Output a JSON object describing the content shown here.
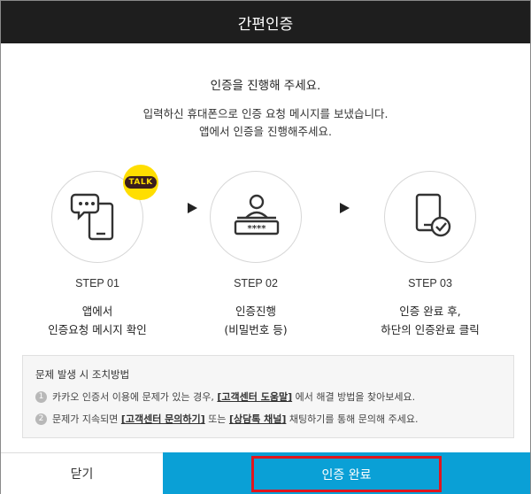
{
  "header": {
    "title": "간편인증"
  },
  "intro": {
    "lead": "인증을 진행해 주세요.",
    "desc_line1": "입력하신 휴대폰으로 인증 요청 메시지를 보냈습니다.",
    "desc_line2": "앱에서 인증을 진행해주세요."
  },
  "steps": [
    {
      "label": "STEP 01",
      "line1": "앱에서",
      "line2": "인증요청 메시지 확인",
      "icon": "phone-chat-icon",
      "badge": "TALK"
    },
    {
      "label": "STEP 02",
      "line1": "인증진행",
      "line2": "(비밀번호 등)",
      "icon": "password-user-icon"
    },
    {
      "label": "STEP 03",
      "line1": "인증 완료 후,",
      "line2": "하단의 인증완료 클릭",
      "icon": "phone-check-icon"
    }
  ],
  "help": {
    "title": "문제 발생 시 조치방법",
    "items": [
      {
        "num": "1",
        "pre": "카카오 인증서 이용에 문제가 있는 경우,",
        "link1": "[고객센터 도움말]",
        "post": "에서 해결 방법을 찾아보세요."
      },
      {
        "num": "2",
        "pre": "문제가 지속되면",
        "link1": "[고객센터 문의하기]",
        "mid": "또는",
        "link2": "[상담톡 채널]",
        "post": "채팅하기를 통해 문의해 주세요."
      }
    ]
  },
  "footer": {
    "close_label": "닫기",
    "done_label": "인증 완료"
  },
  "colors": {
    "header_bg": "#1e1e1e",
    "primary": "#0aa0d6",
    "highlight": "#e0161e",
    "talk_yellow": "#ffde00"
  }
}
